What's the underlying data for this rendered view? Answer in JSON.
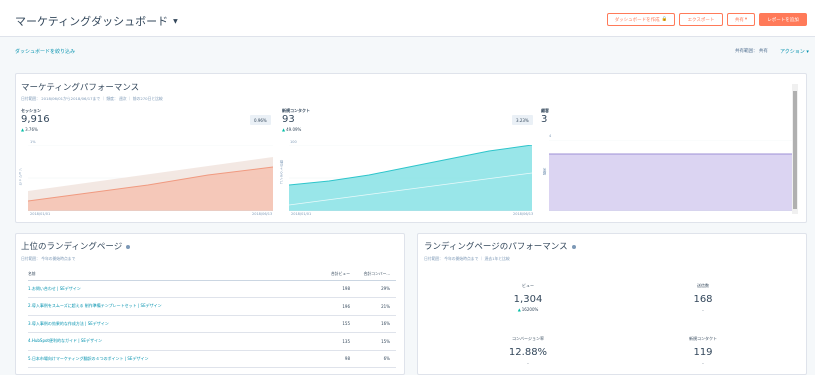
{
  "header": {
    "title": "マーケティングダッシュボード",
    "buttons": {
      "create_dashboard": "ダッシュボードを作成",
      "export": "エクスポート",
      "share": "共有",
      "add_report": "レポートを追加"
    }
  },
  "filter_bar": {
    "filter_link": "ダッシュボードを絞り込み",
    "shared_label": "共有範囲： 共有",
    "actions": "アクション"
  },
  "perf_card": {
    "title": "マーケティングパフォーマンス",
    "meta": "日付範囲： 2018/06/01から2018/06/17まで ｜ 頻度： 週次 ｜ 前の270日と比較",
    "sessions": {
      "label": "セッション",
      "value": "9,916",
      "delta": "3.76%",
      "badge": "0.96%",
      "y_label": "セッション",
      "y_top": "1%"
    },
    "contacts": {
      "label": "新規コンタクト",
      "value": "93",
      "delta": "49.09%",
      "badge": "3.23%",
      "y_label": "コンタクトの数",
      "y_top": "100"
    },
    "customers": {
      "label": "顧客",
      "value": "3",
      "y_label": "顧客",
      "y_top": "4"
    },
    "x_start": "2018/01/01",
    "x_end": "2018/06/13"
  },
  "landing_pages": {
    "title": "上位のランディングページ",
    "meta": "日付範囲： 今年の開始時点まで",
    "columns": [
      "名前",
      "合計ビュー",
      "合計コンバー..."
    ],
    "rows": [
      {
        "name": "1.お問い合わせ | SEデザイン",
        "views": "198",
        "rate": "29%"
      },
      {
        "name": "2.導入事例をスムーズに超える 制作準備テンプレートセット | SEデザイン",
        "views": "196",
        "rate": "21%"
      },
      {
        "name": "3.導入事例の効果的な作成方法 | SEデザイン",
        "views": "155",
        "rate": "16%"
      },
      {
        "name": "4.HubSpot便利的なガイド | SEデザイン",
        "views": "135",
        "rate": "15%"
      },
      {
        "name": "5.日本市場向けマーケティング翻訳の４つのポイント | SEデザイン",
        "views": "98",
        "rate": "6%"
      }
    ]
  },
  "lp_perf": {
    "title": "ランディングページのパフォーマンス",
    "meta": "日付範囲： 今年の開始時点まで ｜ 過去1年と比較",
    "metrics": [
      {
        "label": "ビュー",
        "value": "1,304",
        "sub": "16200%",
        "up": true
      },
      {
        "label": "送信数",
        "value": "168",
        "sub": "-",
        "up": false
      },
      {
        "label": "コンバージョン率",
        "value": "12.88%",
        "sub": "-",
        "up": false
      },
      {
        "label": "新規コンタクト",
        "value": "119",
        "sub": "-",
        "up": false
      }
    ]
  },
  "chart_data": [
    {
      "type": "area",
      "title": "セッション",
      "x": [
        "2018/01/01",
        "2018/06/13"
      ],
      "series": [
        {
          "name": "セッション",
          "values": [
            0.05,
            0.32
          ]
        }
      ],
      "color": "#f5a08a"
    },
    {
      "type": "area",
      "title": "新規コンタクト",
      "x": [
        "2018/01/01",
        "2018/06/13"
      ],
      "series": [
        {
          "name": "新規コンタクト",
          "values": [
            0.25,
            0.78
          ]
        }
      ],
      "color": "#51d3d9"
    },
    {
      "type": "area",
      "title": "顧客",
      "x": [
        "2018/01/01",
        "2018/06/13"
      ],
      "series": [
        {
          "name": "顧客",
          "values": [
            3,
            3
          ]
        }
      ],
      "color": "#c5b8e6"
    }
  ],
  "colors": {
    "accent": "#ff7a59",
    "link": "#0091ae",
    "teal": "#00bda5"
  }
}
